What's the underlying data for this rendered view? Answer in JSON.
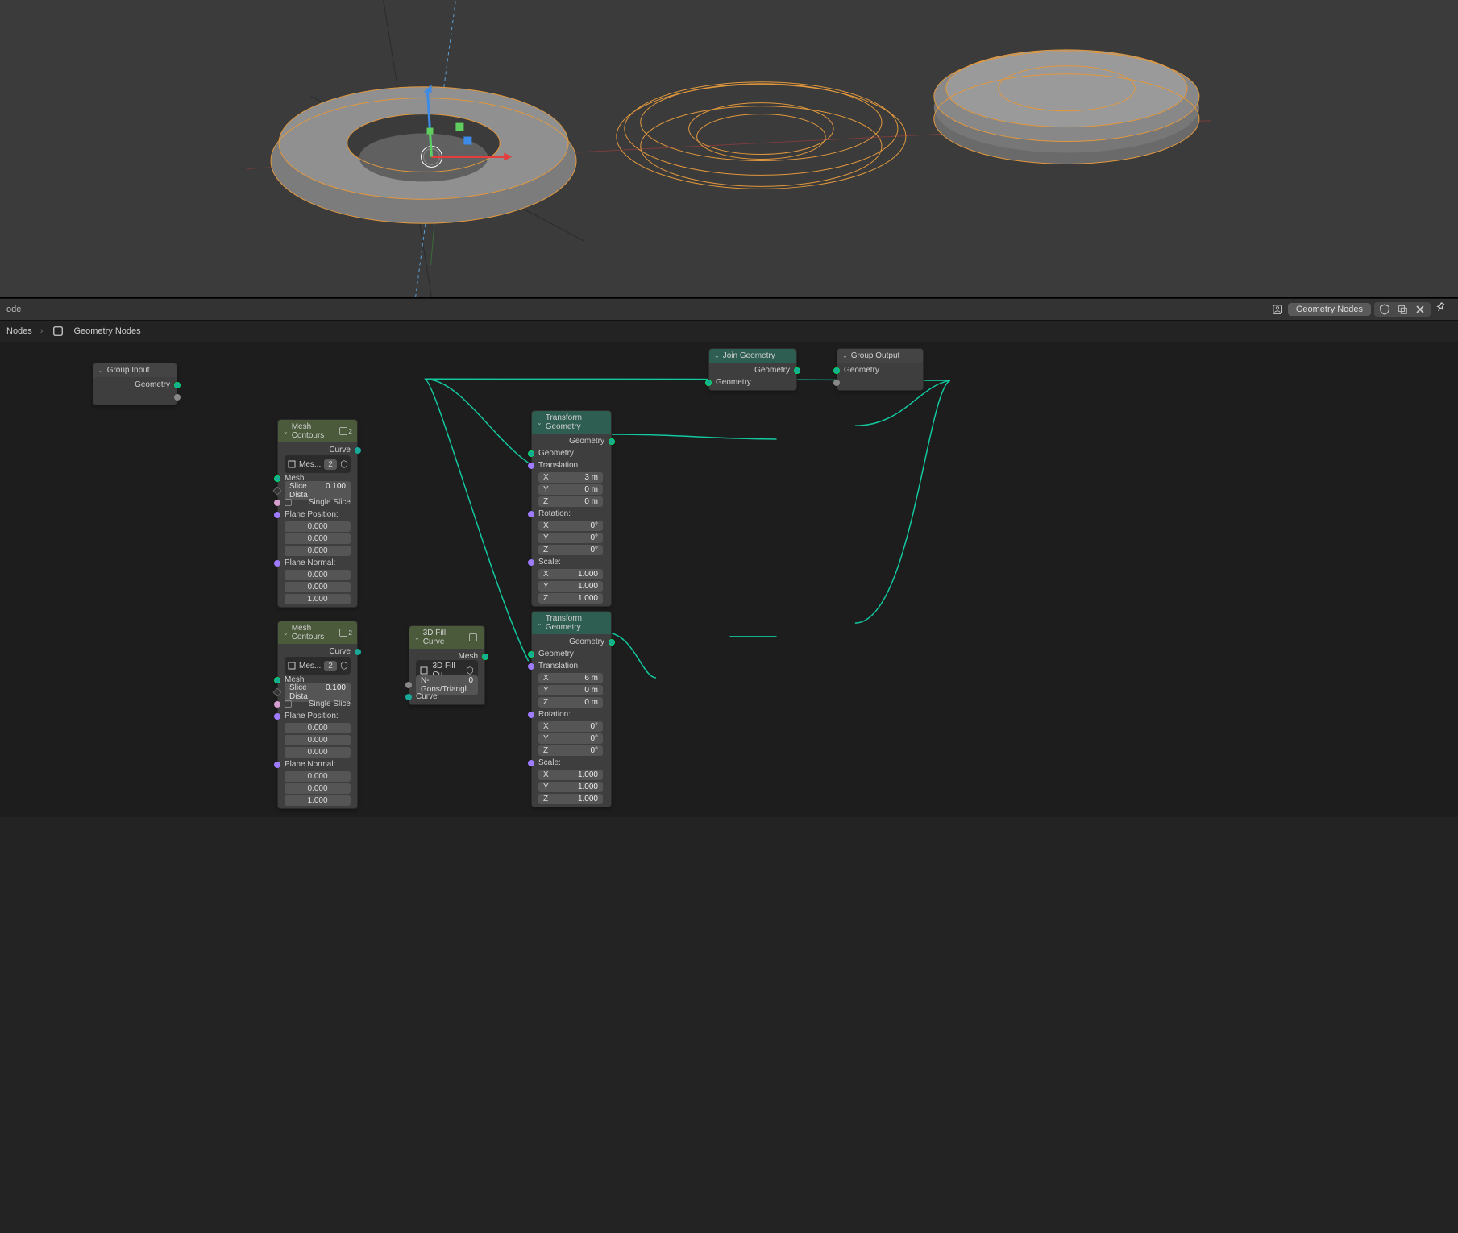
{
  "header": {
    "nodegroup_name": "Geometry Nodes",
    "editor_label": "ode",
    "crumb1": "Nodes",
    "crumb2": "Geometry Nodes"
  },
  "sockets": {
    "geometry": "Geometry",
    "curve": "Curve",
    "mesh": "Mesh"
  },
  "nodes": {
    "group_input": {
      "title": "Group Input",
      "out": "Geometry"
    },
    "group_output": {
      "title": "Group Output",
      "in": "Geometry"
    },
    "join": {
      "title": "Join Geometry",
      "out": "Geometry",
      "in": "Geometry"
    },
    "mesh_contours": {
      "title": "Mesh Contours",
      "count": "2",
      "selector": "Mes...",
      "slice_label": "Slice Dista",
      "slice_val": "0.100",
      "single": "Single Slice",
      "ppos": "Plane Position:",
      "pnorm": "Plane Normal:",
      "pp": [
        "0.000",
        "0.000",
        "0.000"
      ],
      "pn": [
        "0.000",
        "0.000",
        "1.000"
      ]
    },
    "fill": {
      "title": "3D Fill Curve",
      "selector": "3D Fill Cu...",
      "ngons_label": "N-Gons/Triangl",
      "ngons_val": "0",
      "out": "Mesh",
      "in": "Curve"
    },
    "transform": {
      "title": "Transform Geometry",
      "trans_label": "Translation:",
      "rot_label": "Rotation:",
      "scale_label": "Scale:",
      "axes": [
        "X",
        "Y",
        "Z"
      ],
      "a": {
        "t": [
          "3 m",
          "0 m",
          "0 m"
        ],
        "r": [
          "0°",
          "0°",
          "0°"
        ],
        "s": [
          "1.000",
          "1.000",
          "1.000"
        ]
      },
      "b": {
        "t": [
          "6 m",
          "0 m",
          "0 m"
        ],
        "r": [
          "0°",
          "0°",
          "0°"
        ],
        "s": [
          "1.000",
          "1.000",
          "1.000"
        ]
      }
    }
  }
}
